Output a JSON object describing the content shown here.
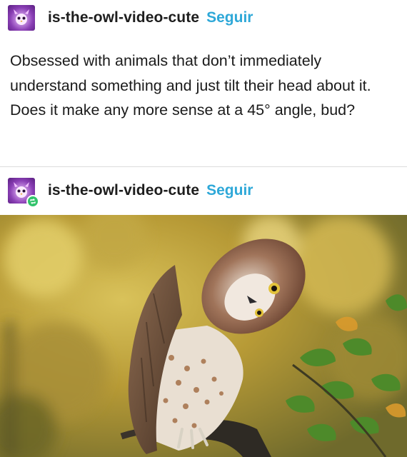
{
  "post1": {
    "username": "is-the-owl-video-cute",
    "follow_label": "Seguir",
    "text": "Obsessed with animals that don’t immediately understand something and just tilt their head about it. Does it make any more sense at a 45° angle, bud?"
  },
  "post2": {
    "username": "is-the-owl-video-cute",
    "follow_label": "Seguir",
    "reblog_icon": "reblog-icon"
  },
  "colors": {
    "follow": "#2ea8d8",
    "reblog_badge": "#32c36b",
    "avatar": "#8a3fb5"
  }
}
